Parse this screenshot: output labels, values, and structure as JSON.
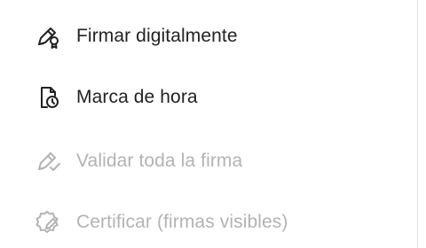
{
  "menu": {
    "items": [
      {
        "label": "Firmar digitalmente",
        "icon": "pen-certificate-icon",
        "enabled": true
      },
      {
        "label": "Marca de hora",
        "icon": "document-clock-icon",
        "enabled": true
      },
      {
        "label": "Validar toda la firma",
        "icon": "pen-check-icon",
        "enabled": false
      },
      {
        "label": "Certificar (firmas visibles)",
        "icon": "badge-pen-icon",
        "enabled": false
      }
    ]
  },
  "colors": {
    "enabled_text": "#222222",
    "disabled_text": "#b3b3b3",
    "divider": "#e1e1e1"
  }
}
